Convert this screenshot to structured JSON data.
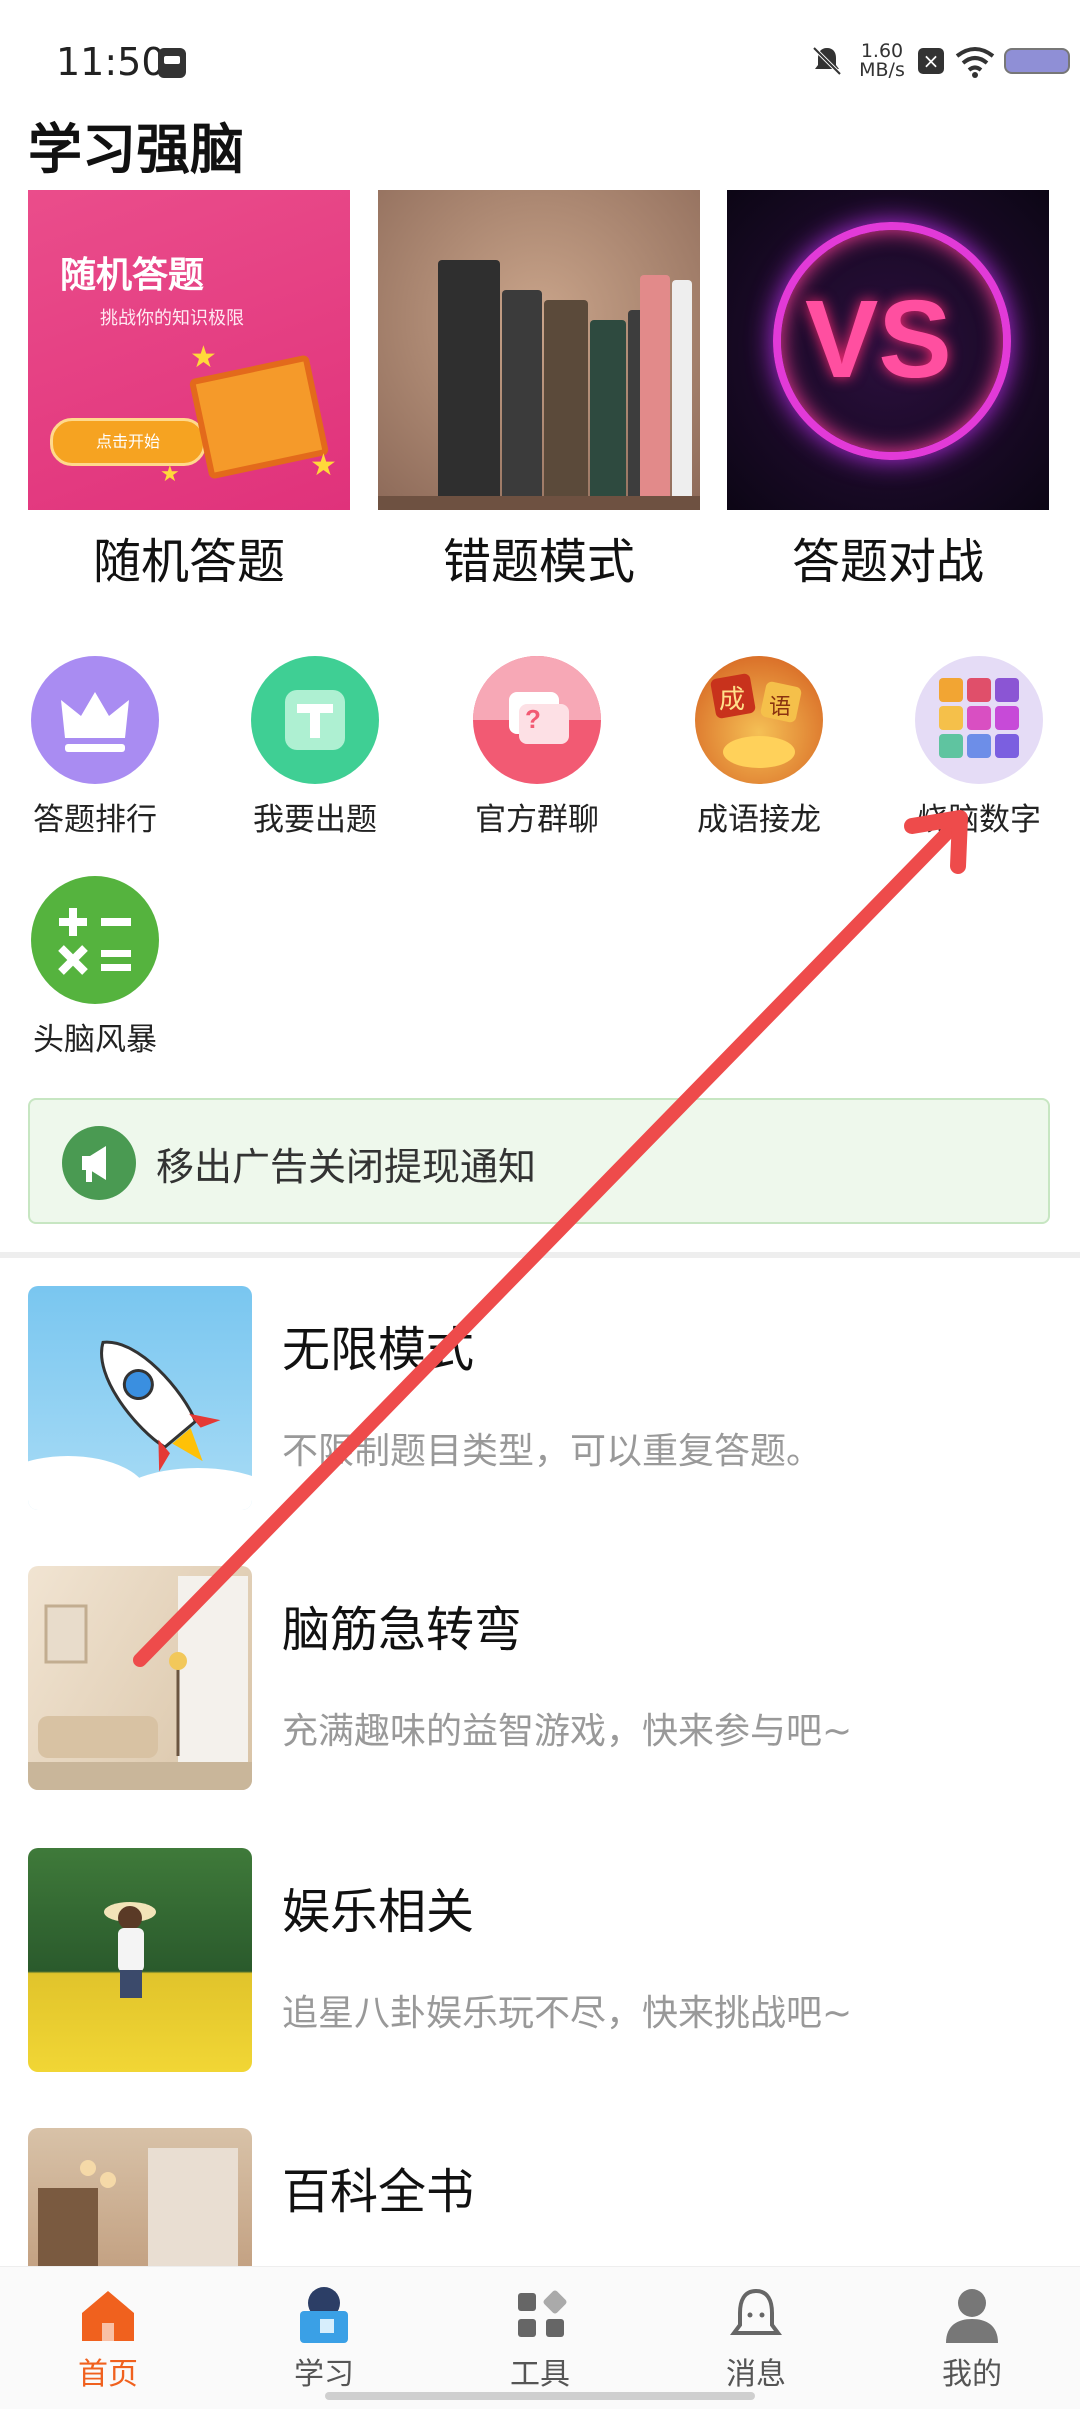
{
  "status_bar": {
    "time": "11:50",
    "net_speed_value": "1.60",
    "net_speed_unit": "MB/s"
  },
  "page": {
    "title": "学习强脑"
  },
  "banners": [
    {
      "caption": "随机答题",
      "art_title": "随机答题",
      "art_subtitle": "挑战你的知识极限",
      "art_button": "点击开始"
    },
    {
      "caption": "错题模式"
    },
    {
      "caption": "答题对战",
      "art_text": "VS"
    }
  ],
  "grid": [
    {
      "label": "答题排行",
      "icon": "crown-icon"
    },
    {
      "label": "我要出题",
      "icon": "t-letter-icon"
    },
    {
      "label": "官方群聊",
      "icon": "chat-question-icon"
    },
    {
      "label": "成语接龙",
      "icon": "idiom-ingot-icon",
      "chars": [
        "成",
        "语"
      ]
    },
    {
      "label": "烧脑数字",
      "icon": "color-grid-icon"
    },
    {
      "label": "头脑风暴",
      "icon": "math-operators-icon"
    }
  ],
  "notice": {
    "text": "移出广告关闭提现通知",
    "icon": "megaphone-icon"
  },
  "list": [
    {
      "title": "无限模式",
      "desc": "不限制题目类型，可以重复答题。"
    },
    {
      "title": "脑筋急转弯",
      "desc": "充满趣味的益智游戏，快来参与吧~"
    },
    {
      "title": "娱乐相关",
      "desc": "追星八卦娱乐玩不尽，快来挑战吧~"
    },
    {
      "title": "百科全书",
      "desc": ""
    }
  ],
  "bottom_nav": [
    {
      "label": "首页",
      "active": true
    },
    {
      "label": "学习",
      "active": false
    },
    {
      "label": "工具",
      "active": false
    },
    {
      "label": "消息",
      "active": false
    },
    {
      "label": "我的",
      "active": false
    }
  ],
  "colors": {
    "accent": "#f0611e",
    "annotation_arrow": "#ee4b4b"
  }
}
